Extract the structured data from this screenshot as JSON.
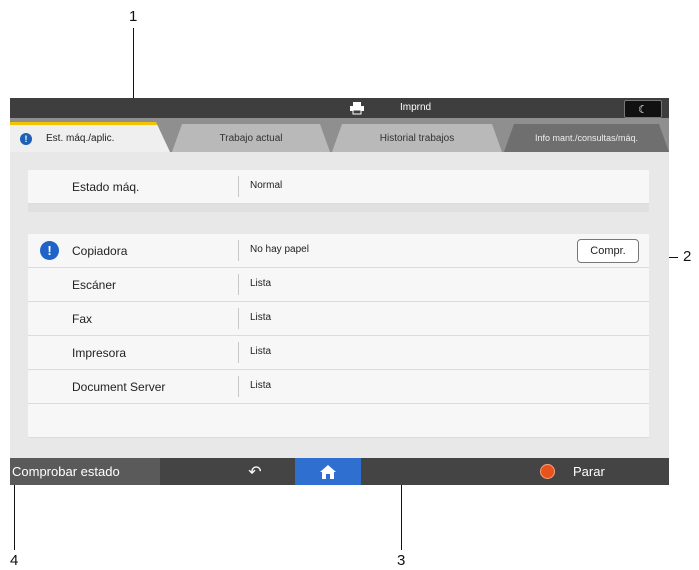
{
  "callouts": [
    "1",
    "2",
    "3",
    "4"
  ],
  "topbar": {
    "status_text": "Imprnd",
    "printer_icon": "printer-icon",
    "moon_icon": "moon-icon"
  },
  "tabs": [
    {
      "label": "Est. máq./aplic.",
      "active": true,
      "badge": "!"
    },
    {
      "label": "Trabajo actual",
      "active": false
    },
    {
      "label": "Historial trabajos",
      "active": false
    },
    {
      "label": "Info mant./consultas/máq.",
      "active": false
    }
  ],
  "machine": {
    "name": "Estado máq.",
    "value": "Normal"
  },
  "functions": [
    {
      "name": "Copiadora",
      "value": "No hay papel",
      "alert": true,
      "button": "Compr."
    },
    {
      "name": "Escáner",
      "value": "Lista"
    },
    {
      "name": "Fax",
      "value": "Lista"
    },
    {
      "name": "Impresora",
      "value": "Lista"
    },
    {
      "name": "Document Server",
      "value": "Lista"
    }
  ],
  "bottombar": {
    "check_status": "Comprobar estado",
    "stop": "Parar",
    "back_icon": "back-icon",
    "home_icon": "home-icon",
    "stop_icon": "stop-icon"
  },
  "colors": {
    "accent_tab": "#f3c300",
    "info_blue": "#1f63c8",
    "stop_orange": "#e8531c",
    "home_blue": "#2f6fd0"
  }
}
